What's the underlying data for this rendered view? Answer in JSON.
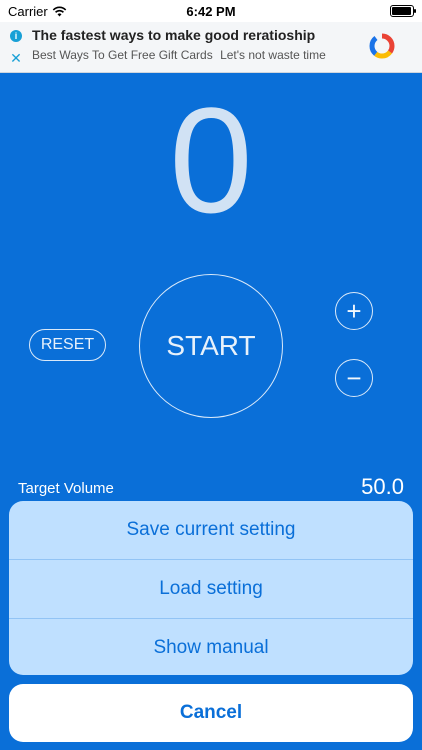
{
  "status_bar": {
    "carrier": "Carrier",
    "time": "6:42 PM"
  },
  "ad": {
    "title": "The fastest ways to make good reratioship",
    "subtitle": "Best Ways To Get Free Gift Cards",
    "tagline": "Let's not waste time"
  },
  "counter": {
    "value": "0"
  },
  "controls": {
    "start_label": "START",
    "reset_label": "RESET",
    "plus_label": "+",
    "minus_label": "−"
  },
  "target": {
    "label": "Target Volume",
    "value": "50.0"
  },
  "action_sheet": {
    "items": [
      {
        "label": "Save current setting"
      },
      {
        "label": "Load setting"
      },
      {
        "label": "Show manual"
      }
    ],
    "cancel_label": "Cancel"
  },
  "colors": {
    "background": "#0a6fd8",
    "sheet": "#bfe0ff",
    "accent": "#0a6fd8"
  }
}
